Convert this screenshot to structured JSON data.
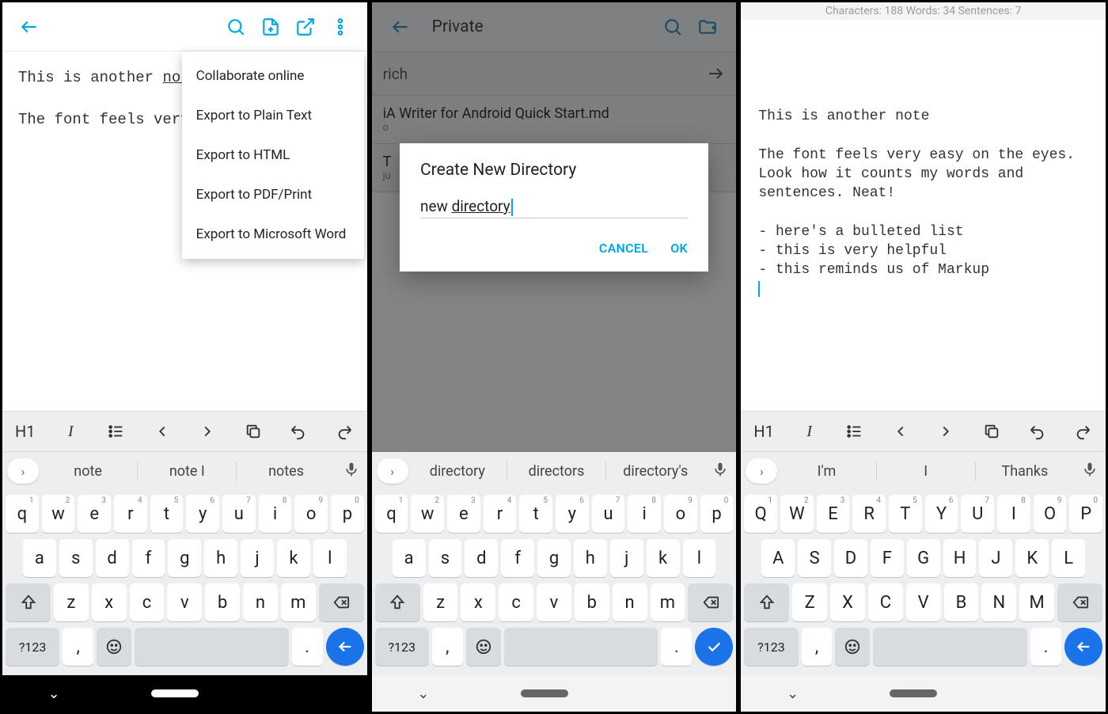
{
  "screen1": {
    "editor_line1_pre": "This is another ",
    "editor_line1_underlined": "note",
    "editor_line2": "The font feels very",
    "menu": {
      "items": [
        "Collaborate online",
        "Export to Plain Text",
        "Export to HTML",
        "Export to PDF/Print",
        "Export to Microsoft Word"
      ]
    },
    "fmt": {
      "h1": "H1",
      "italic": "I"
    },
    "suggestions": [
      "note",
      "note I",
      "notes"
    ],
    "kb_numbers": [
      "1",
      "2",
      "3",
      "4",
      "5",
      "6",
      "7",
      "8",
      "9",
      "0"
    ],
    "kb_row1": [
      "q",
      "w",
      "e",
      "r",
      "t",
      "y",
      "u",
      "i",
      "o",
      "p"
    ],
    "kb_row2": [
      "a",
      "s",
      "d",
      "f",
      "g",
      "h",
      "j",
      "k",
      "l"
    ],
    "kb_row3": [
      "z",
      "x",
      "c",
      "v",
      "b",
      "n",
      "m"
    ],
    "kb_sym": "?123",
    "kb_comma": ",",
    "kb_period": "."
  },
  "screen2": {
    "title": "Private",
    "search_text": "rich",
    "file1": {
      "name": "iA Writer for Android Quick Start.md",
      "sub": "o"
    },
    "file2": {
      "name": "T",
      "sub": "ju"
    },
    "dialog": {
      "title": "Create New Directory",
      "input_pre": "new ",
      "input_underlined": "directory",
      "cancel": "CANCEL",
      "ok": "OK"
    },
    "suggestions": [
      "directory",
      "directors",
      "directory's"
    ],
    "kb_row1": [
      "q",
      "w",
      "e",
      "r",
      "t",
      "y",
      "u",
      "i",
      "o",
      "p"
    ],
    "kb_row2": [
      "a",
      "s",
      "d",
      "f",
      "g",
      "h",
      "j",
      "k",
      "l"
    ],
    "kb_row3": [
      "z",
      "x",
      "c",
      "v",
      "b",
      "n",
      "m"
    ],
    "kb_sym": "?123",
    "kb_comma": ",",
    "kb_period": "."
  },
  "screen3": {
    "stats": "Characters: 188 Words: 34 Sentences: 7",
    "body": "This is another note\n\nThe font feels very easy on the eyes.\nLook how it counts my words and\nsentences. Neat!\n\n- here's a bulleted list\n- this is very helpful\n- this reminds us of Markup",
    "fmt": {
      "h1": "H1",
      "italic": "I"
    },
    "suggestions": [
      "I'm",
      "I",
      "Thanks"
    ],
    "kb_row1": [
      "Q",
      "W",
      "E",
      "R",
      "T",
      "Y",
      "U",
      "I",
      "O",
      "P"
    ],
    "kb_row2": [
      "A",
      "S",
      "D",
      "F",
      "G",
      "H",
      "J",
      "K",
      "L"
    ],
    "kb_row3": [
      "Z",
      "X",
      "C",
      "V",
      "B",
      "N",
      "M"
    ],
    "kb_sym": "?123",
    "kb_comma": ",",
    "kb_period": "."
  }
}
